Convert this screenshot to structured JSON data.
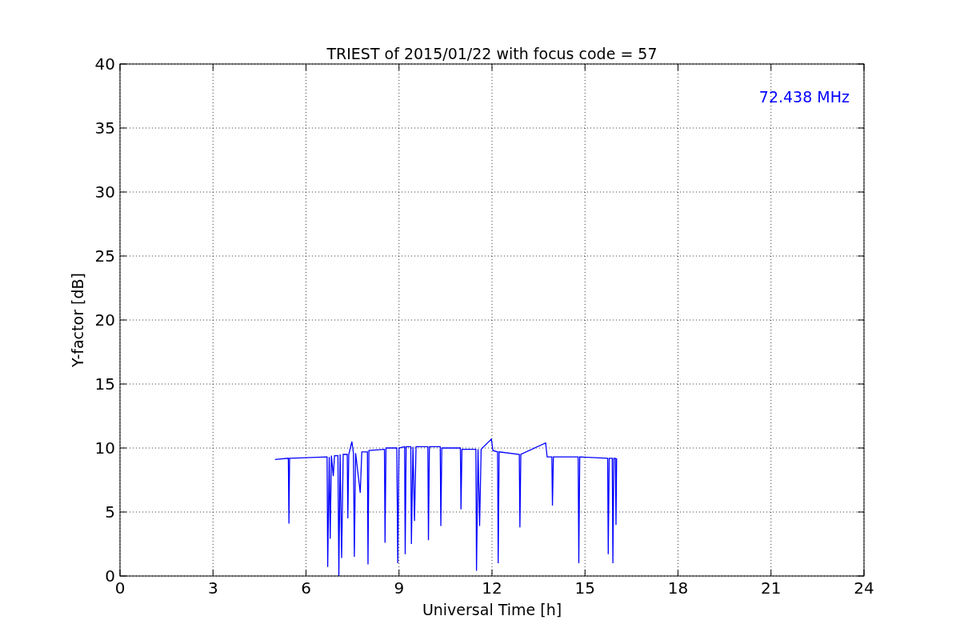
{
  "chart_data": {
    "type": "line",
    "title": "TRIEST of 2015/01/22 with focus code = 57",
    "xlabel": "Universal Time [h]",
    "ylabel": "Y-factor [dB]",
    "x": [
      5,
      5.43,
      5.45,
      5.47,
      6.68,
      6.7,
      6.75,
      6.78,
      6.82,
      6.88,
      6.92,
      7.03,
      7.06,
      7.1,
      7.15,
      7.2,
      7.33,
      7.35,
      7.38,
      7.48,
      7.53,
      7.56,
      7.6,
      7.75,
      7.8,
      7.98,
      8.0,
      8.03,
      8.53,
      8.55,
      8.58,
      8.93,
      8.96,
      9.0,
      9.18,
      9.2,
      9.23,
      9.38,
      9.4,
      9.45,
      9.5,
      9.55,
      9.93,
      9.95,
      9.98,
      10.33,
      10.35,
      10.38,
      10.98,
      11.0,
      11.03,
      11.48,
      11.5,
      11.55,
      11.6,
      11.65,
      11.98,
      12.03,
      12.18,
      12.2,
      12.23,
      12.88,
      12.9,
      12.93,
      13.73,
      13.78,
      13.93,
      13.95,
      13.98,
      14.78,
      14.8,
      14.83,
      15.73,
      15.75,
      15.78,
      15.88,
      15.9,
      15.93,
      15.98,
      16.0,
      16.02
    ],
    "series": [
      {
        "name": "72.438 MHz",
        "color": "#0000ff",
        "values": [
          9.1,
          9.2,
          4.1,
          9.2,
          9.3,
          0.7,
          9.3,
          2.9,
          9.4,
          7.8,
          9.4,
          9.4,
          0.0,
          9.5,
          1.4,
          9.5,
          9.5,
          4.5,
          9.5,
          10.5,
          9.6,
          1.5,
          9.6,
          6.5,
          9.7,
          9.7,
          0.9,
          9.8,
          9.9,
          2.6,
          10.0,
          10.0,
          1.0,
          10.0,
          10.1,
          1.7,
          10.1,
          10.1,
          2.5,
          10.1,
          4.3,
          10.1,
          10.1,
          2.8,
          10.1,
          10.1,
          3.9,
          10.0,
          10.0,
          5.2,
          9.9,
          9.9,
          0.4,
          9.9,
          3.9,
          9.9,
          10.7,
          9.8,
          9.7,
          1.0,
          9.7,
          9.5,
          3.8,
          9.5,
          10.4,
          9.3,
          9.3,
          5.5,
          9.3,
          9.3,
          1.0,
          9.3,
          9.2,
          1.7,
          9.2,
          9.2,
          1.0,
          9.2,
          9.2,
          4.0,
          9.2
        ]
      }
    ],
    "xlim": [
      0,
      24
    ],
    "ylim": [
      0,
      40
    ],
    "xticks": [
      0,
      3,
      6,
      9,
      12,
      15,
      18,
      21,
      24
    ],
    "yticks": [
      0,
      5,
      10,
      15,
      20,
      25,
      30,
      35,
      40
    ],
    "grid": true
  }
}
